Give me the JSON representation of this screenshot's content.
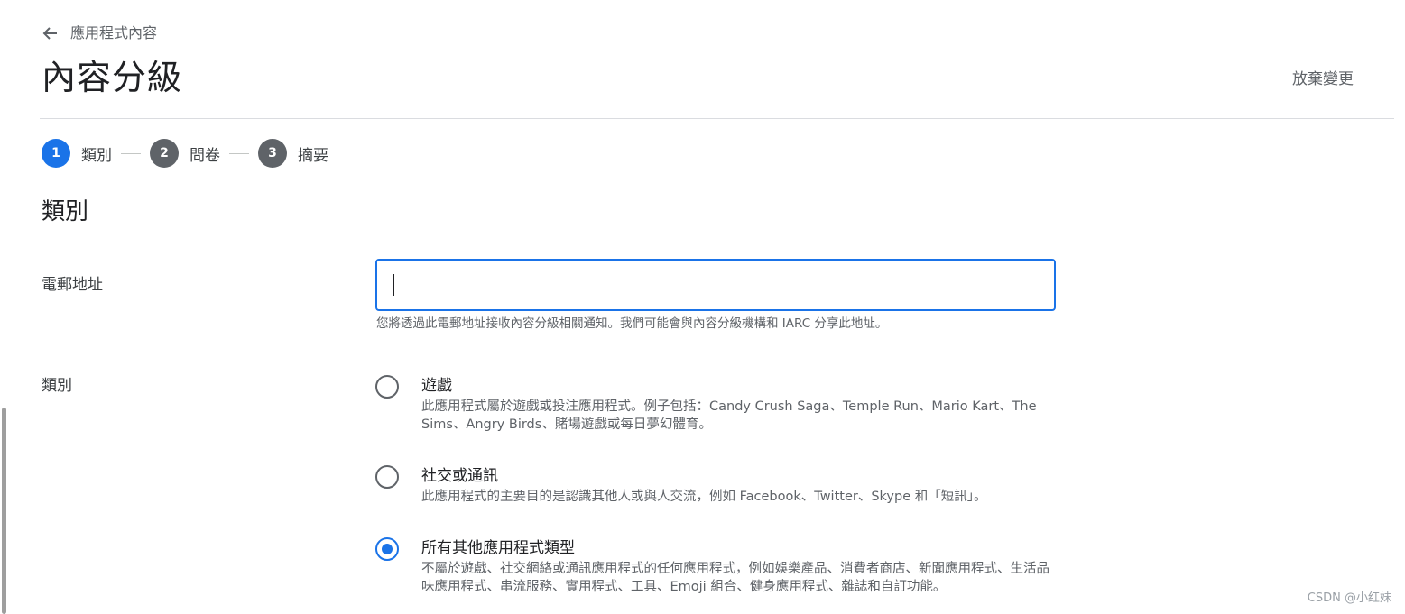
{
  "back": {
    "icon": "arrow-left-icon",
    "label": "應用程式內容"
  },
  "header": {
    "title": "內容分級",
    "discard_label": "放棄變更"
  },
  "stepper": {
    "steps": [
      {
        "number": "1",
        "label": "類別",
        "active": true
      },
      {
        "number": "2",
        "label": "問卷",
        "active": false
      },
      {
        "number": "3",
        "label": "摘要",
        "active": false
      }
    ]
  },
  "section": {
    "title": "類別"
  },
  "email": {
    "label": "電郵地址",
    "value": "",
    "helper": "您將透過此電郵地址接收內容分級相關通知。我們可能會與內容分級機構和 IARC 分享此地址。"
  },
  "category": {
    "label": "類別",
    "options": [
      {
        "title": "遊戲",
        "description": "此應用程式屬於遊戲或投注應用程式。例子包括：Candy Crush Saga、Temple Run、Mario Kart、The Sims、Angry Birds、賭場遊戲或每日夢幻體育。",
        "selected": false
      },
      {
        "title": "社交或通訊",
        "description": "此應用程式的主要目的是認識其他人或與人交流，例如 Facebook、Twitter、Skype 和「短訊」。",
        "selected": false
      },
      {
        "title": "所有其他應用程式類型",
        "description": "不屬於遊戲、社交網絡或通訊應用程式的任何應用程式，例如娛樂產品、消費者商店、新聞應用程式、生活品味應用程式、串流服務、實用程式、工具、Emoji 組合、健身應用程式、雜誌和自訂功能。",
        "selected": true
      }
    ]
  },
  "watermark": "CSDN @小红妹",
  "colors": {
    "accent": "#1a73e8",
    "inactive_step": "#5f6368",
    "divider": "#dadce0"
  }
}
